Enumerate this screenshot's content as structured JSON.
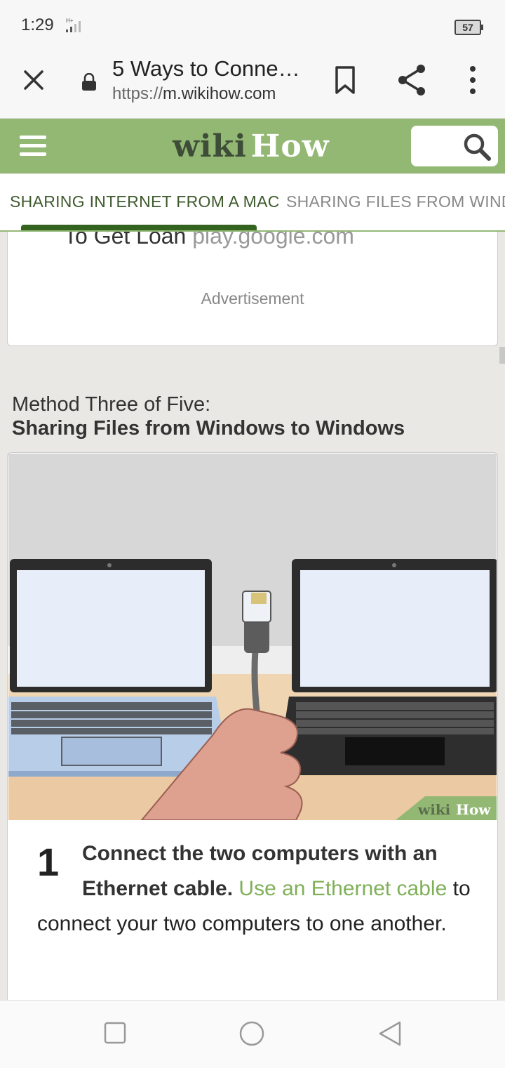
{
  "status_bar": {
    "time": "1:29",
    "network": "H+",
    "battery": "57"
  },
  "browser": {
    "title": "5 Ways to Conne…",
    "url_scheme": "https://",
    "url_host": "m.wikihow.com",
    "icons": [
      "close-icon",
      "lock-icon",
      "bookmark-icon",
      "share-icon",
      "more-vert-icon"
    ]
  },
  "site_header": {
    "logo_wiki": "wiki",
    "logo_how": "How",
    "brand_color": "#93b874",
    "logo_dark_color": "#3e4d37"
  },
  "tabs": [
    {
      "label": "SHARING INTERNET FROM A MAC",
      "active": true
    },
    {
      "label": "SHARING FILES FROM WINDO",
      "active": false
    }
  ],
  "ad": {
    "text": "To Get Loan",
    "domain": "play.google.com",
    "label": "Advertisement"
  },
  "method": {
    "prefix": "Method Three of Five:",
    "title": "Sharing Files from Windows to Windows"
  },
  "step": {
    "number": "1",
    "heading_line1": "Connect the two computers with an",
    "heading_line2": "Ethernet cable.",
    "link_text": "Use an Ethernet cable",
    "body": "to connect your two computers to one another.",
    "watermark_wiki": "wiki",
    "watermark_how": "How",
    "link_color": "#7fb058"
  },
  "nav_bar": {
    "icons": [
      "recent-apps-icon",
      "home-icon",
      "back-icon"
    ]
  }
}
